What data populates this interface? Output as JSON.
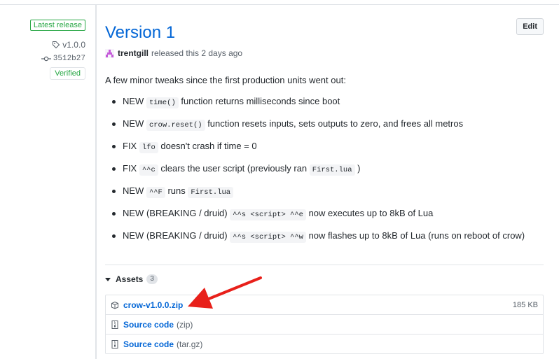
{
  "sidebar": {
    "latest_release_label": "Latest release",
    "tag": "v1.0.0",
    "commit": "3512b27",
    "verified_label": "Verified"
  },
  "release": {
    "title": "Version 1",
    "edit_label": "Edit",
    "author": "trentgill",
    "released_text": "released this 2 days ago",
    "intro": "A few minor tweaks since the first production units went out:",
    "notes": [
      {
        "parts": [
          {
            "t": "NEW "
          },
          {
            "c": "time()"
          },
          {
            "t": " function returns milliseconds since boot"
          }
        ]
      },
      {
        "parts": [
          {
            "t": "NEW "
          },
          {
            "c": "crow.reset()"
          },
          {
            "t": " function resets inputs, sets outputs to zero, and frees all metros"
          }
        ]
      },
      {
        "parts": [
          {
            "t": "FIX "
          },
          {
            "c": "lfo"
          },
          {
            "t": " doesn't crash if time = 0"
          }
        ]
      },
      {
        "parts": [
          {
            "t": "FIX "
          },
          {
            "c": "^^c"
          },
          {
            "t": " clears the user script (previously ran "
          },
          {
            "c": "First.lua"
          },
          {
            "t": " )"
          }
        ]
      },
      {
        "parts": [
          {
            "t": "NEW "
          },
          {
            "c": "^^F"
          },
          {
            "t": " runs "
          },
          {
            "c": "First.lua"
          }
        ]
      },
      {
        "parts": [
          {
            "t": "NEW (BREAKING / druid) "
          },
          {
            "c": "^^s <script> ^^e"
          },
          {
            "t": " now executes up to 8kB of Lua"
          }
        ]
      },
      {
        "parts": [
          {
            "t": "NEW (BREAKING / druid) "
          },
          {
            "c": "^^s <script> ^^w"
          },
          {
            "t": " now flashes up to 8kB of Lua (runs on reboot of crow)"
          }
        ]
      }
    ]
  },
  "assets": {
    "label": "Assets",
    "count": "3",
    "items": [
      {
        "name": "crow-v1.0.0.zip",
        "ext": "",
        "size": "185 KB",
        "icon": "package-icon"
      },
      {
        "name": "Source code",
        "ext": "(zip)",
        "size": "",
        "icon": "file-zip-icon"
      },
      {
        "name": "Source code",
        "ext": "(tar.gz)",
        "size": "",
        "icon": "file-zip-icon"
      }
    ]
  },
  "colors": {
    "link": "#0366d6",
    "success": "#28a745",
    "annotation_arrow": "#e8201a"
  }
}
